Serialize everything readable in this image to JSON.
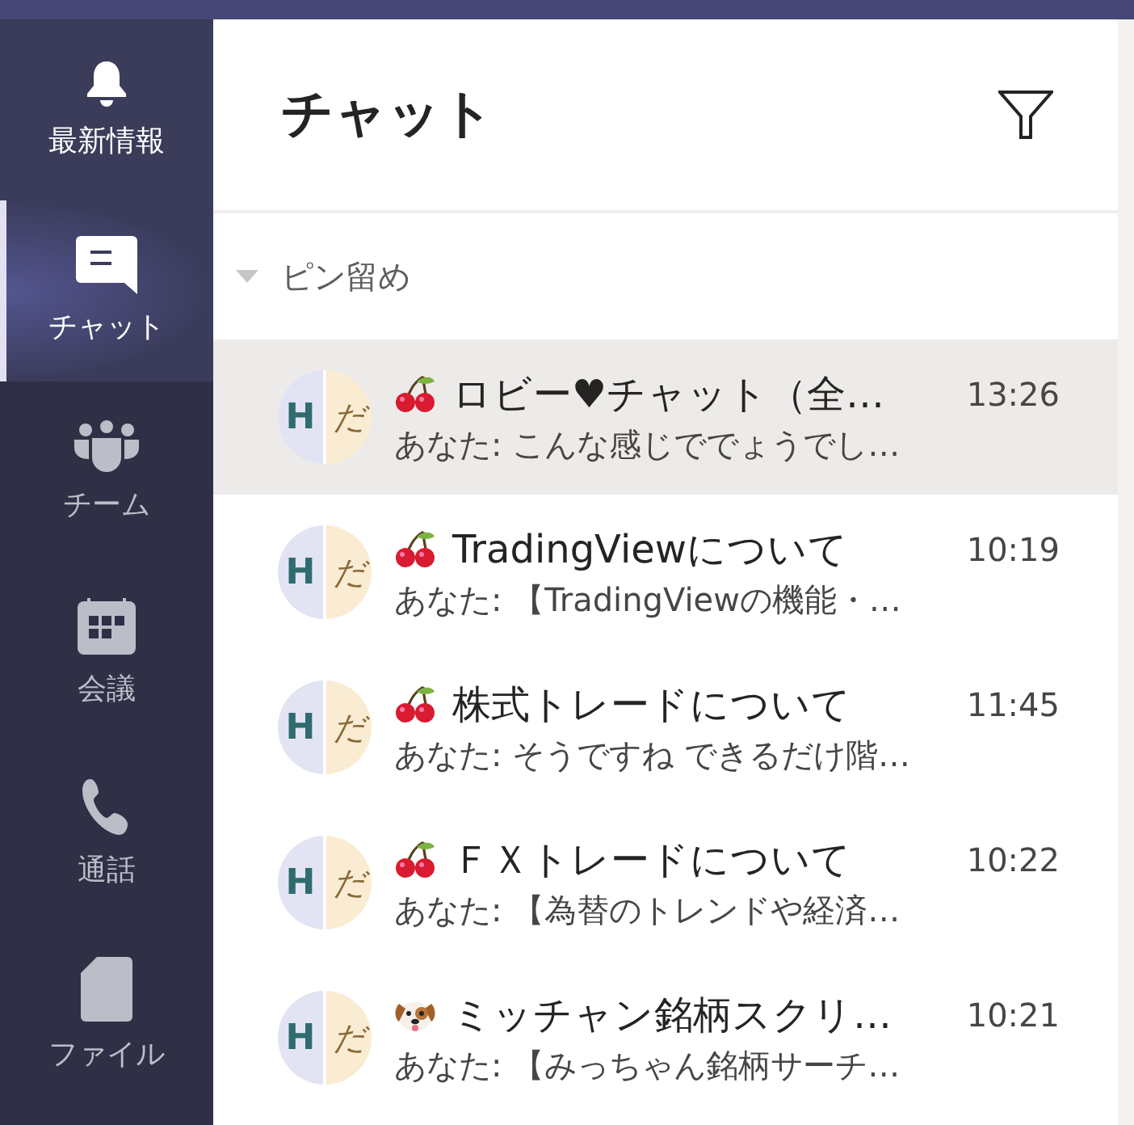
{
  "rail": [
    {
      "kind": "bell",
      "label": "最新情報",
      "selected": false,
      "hovered": true
    },
    {
      "kind": "chat",
      "label": "チャット",
      "selected": true,
      "hovered": false
    },
    {
      "kind": "team",
      "label": "チーム",
      "selected": false,
      "hovered": false
    },
    {
      "kind": "calendar",
      "label": "会議",
      "selected": false,
      "hovered": false
    },
    {
      "kind": "phone",
      "label": "通話",
      "selected": false,
      "hovered": false
    },
    {
      "kind": "file",
      "label": "ファイル",
      "selected": false,
      "hovered": false
    }
  ],
  "header": {
    "title": "チャット"
  },
  "section": {
    "label": "ピン留め",
    "expanded": true
  },
  "chats": [
    {
      "kind": "cherry",
      "title": "ロビー♥チャット（全…",
      "time": "13:26",
      "preview": "あなた: こんな感じででょうでし…",
      "avatar": [
        "H",
        "だ"
      ],
      "selected": true
    },
    {
      "kind": "cherry",
      "title": "TradingViewについて",
      "time": "10:19",
      "preview": "あなた: 【TradingViewの機能・…",
      "avatar": [
        "H",
        "だ"
      ],
      "selected": false
    },
    {
      "kind": "cherry",
      "title": "株式トレードについて",
      "time": "11:45",
      "preview": "あなた: そうですね できるだけ階…",
      "avatar": [
        "H",
        "だ"
      ],
      "selected": false
    },
    {
      "kind": "cherry",
      "title": "ＦＸトレードについて",
      "time": "10:22",
      "preview": "あなた: 【為替のトレンドや経済…",
      "avatar": [
        "H",
        "だ"
      ],
      "selected": false
    },
    {
      "kind": "dog",
      "title": "ミッチャン銘柄スクリ…",
      "time": "10:21",
      "preview": "あなた: 【みっちゃん銘柄サーチ…",
      "avatar": [
        "H",
        "だ"
      ],
      "selected": false
    }
  ]
}
